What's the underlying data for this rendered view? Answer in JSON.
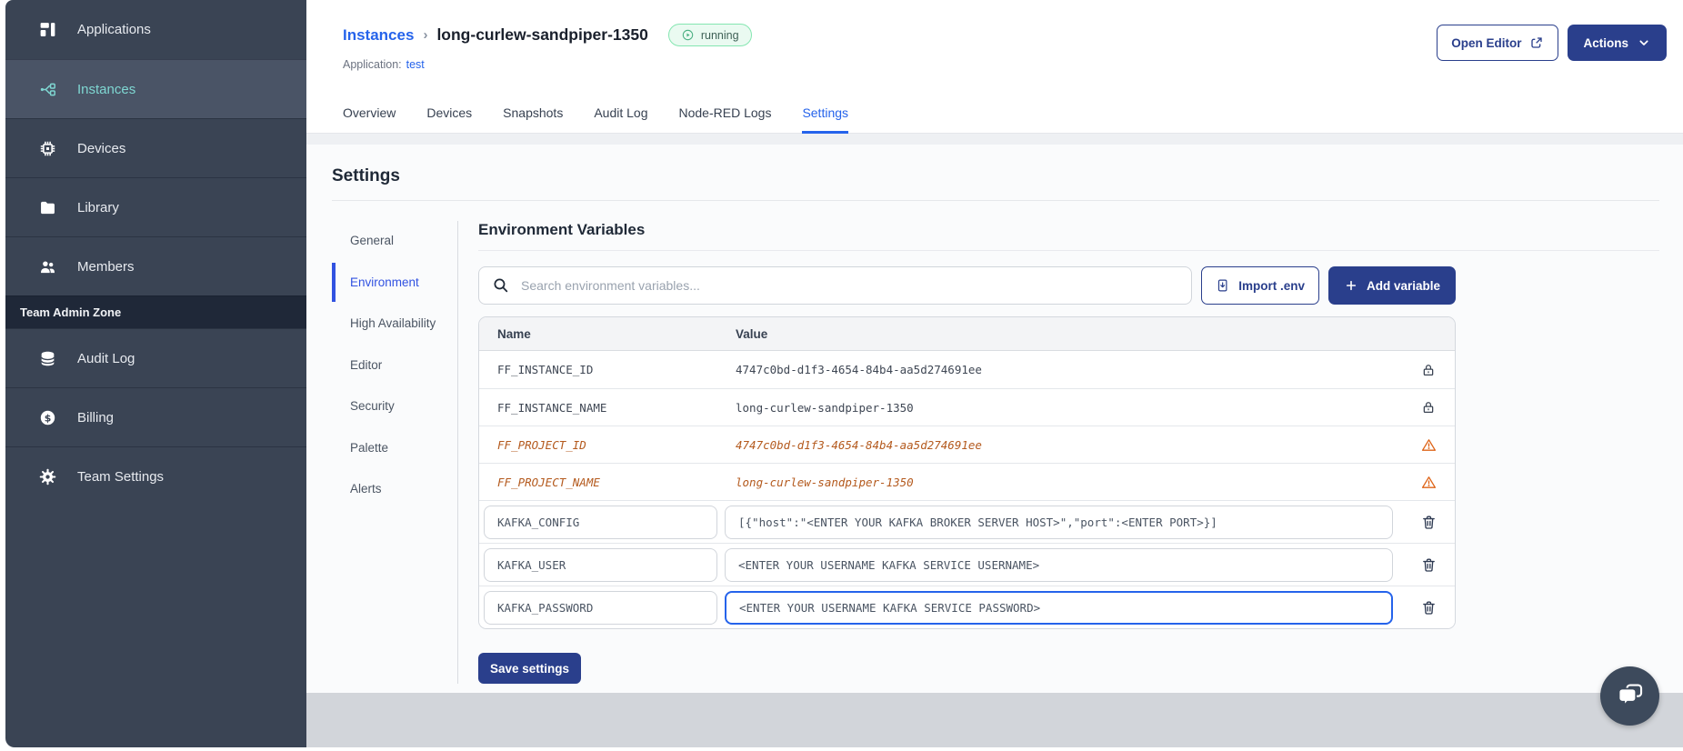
{
  "colors": {
    "sidebar_bg": "#3a4454",
    "sidebar_active_bg": "#4a5466",
    "sidebar_teal": "#7fd7d2",
    "admin_zone_bg": "#1f2838",
    "primary": "#2a3f8c",
    "link": "#2563eb",
    "nav_active": "#3152e1",
    "dep_text": "#b45a1e",
    "warn": "#de6418",
    "badge_bg": "#eafaf1",
    "badge_border": "#85e6b1",
    "badge_text": "#3f6156",
    "badge_icon": "#4aaf82",
    "focus": "#2563eb",
    "chat_bg": "#3d4a5c",
    "bottom_strip": "#d2d5da"
  },
  "sidebar": {
    "items": [
      {
        "label": "Applications",
        "icon": "applications-icon",
        "active": false
      },
      {
        "label": "Instances",
        "icon": "instances-icon",
        "active": true
      },
      {
        "label": "Devices",
        "icon": "devices-icon",
        "active": false
      },
      {
        "label": "Library",
        "icon": "library-icon",
        "active": false
      },
      {
        "label": "Members",
        "icon": "members-icon",
        "active": false
      }
    ],
    "section_label": "Team Admin Zone",
    "admin_items": [
      {
        "label": "Audit Log",
        "icon": "audit-log-icon",
        "active": false
      },
      {
        "label": "Billing",
        "icon": "billing-icon",
        "active": false
      },
      {
        "label": "Team Settings",
        "icon": "team-settings-icon",
        "active": false
      }
    ]
  },
  "header": {
    "breadcrumb_parent": "Instances",
    "breadcrumb_separator": "›",
    "title": "long-curlew-sandpiper-1350",
    "status": "running",
    "application_label": "Application:",
    "application_name": "test",
    "open_editor_label": "Open Editor",
    "actions_label": "Actions"
  },
  "tabs": [
    "Overview",
    "Devices",
    "Snapshots",
    "Audit Log",
    "Node-RED Logs",
    "Settings"
  ],
  "active_tab": "Settings",
  "settings": {
    "title": "Settings",
    "nav": [
      "General",
      "Environment",
      "High Availability",
      "Editor",
      "Security",
      "Palette",
      "Alerts"
    ],
    "active_nav": "Environment",
    "section_title": "Environment Variables",
    "search_placeholder": "Search environment variables...",
    "import_button": "Import .env",
    "add_button": "Add variable",
    "save_button": "Save settings",
    "table": {
      "columns": [
        "Name",
        "Value"
      ],
      "rows": [
        {
          "name": "FF_INSTANCE_ID",
          "value": "4747c0bd-d1f3-4654-84b4-aa5d274691ee",
          "type": "locked"
        },
        {
          "name": "FF_INSTANCE_NAME",
          "value": "long-curlew-sandpiper-1350",
          "type": "locked"
        },
        {
          "name": "FF_PROJECT_ID",
          "value": "4747c0bd-d1f3-4654-84b4-aa5d274691ee",
          "type": "deprecated"
        },
        {
          "name": "FF_PROJECT_NAME",
          "value": "long-curlew-sandpiper-1350",
          "type": "deprecated"
        },
        {
          "name": "KAFKA_CONFIG",
          "value": "[{\"host\":\"<ENTER YOUR KAFKA BROKER SERVER HOST>\",\"port\":<ENTER PORT>}]",
          "type": "editable",
          "focused": false
        },
        {
          "name": "KAFKA_USER",
          "value": "<ENTER YOUR USERNAME KAFKA SERVICE USERNAME>",
          "type": "editable",
          "focused": false
        },
        {
          "name": "KAFKA_PASSWORD",
          "value": "<ENTER YOUR USERNAME KAFKA SERVICE PASSWORD>",
          "type": "editable",
          "focused": true
        }
      ]
    }
  }
}
